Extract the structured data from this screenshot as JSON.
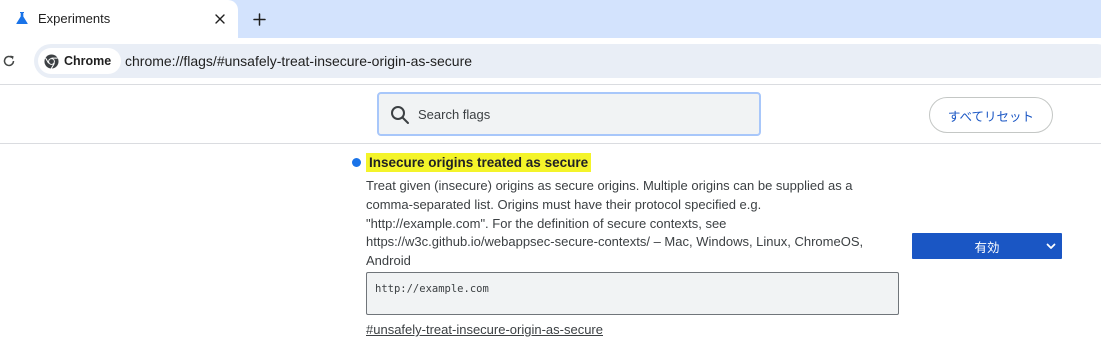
{
  "tab": {
    "title": "Experiments",
    "favicon": "flask-icon",
    "close_icon": "close-icon",
    "new_tab_icon": "plus-icon"
  },
  "toolbar": {
    "reload_icon": "reload-icon",
    "chip_label": "Chrome",
    "chip_icon": "chrome-logo-icon",
    "url": "chrome://flags/#unsafely-treat-insecure-origin-as-secure"
  },
  "header": {
    "search_placeholder": "Search flags",
    "search_icon": "search-icon",
    "reset_label": "すべてリセット"
  },
  "flag": {
    "title": "Insecure origins treated as secure",
    "description_lines": [
      "Treat given (insecure) origins as secure origins. Multiple origins can be supplied as a",
      "comma-separated list. Origins must have their protocol specified e.g.",
      "\"http://example.com\". For the definition of secure contexts, see",
      "https://w3c.github.io/webappsec-secure-contexts/ – Mac, Windows, Linux, ChromeOS,",
      "Android"
    ],
    "textarea_value": "http://example.com",
    "link": "#unsafely-treat-insecure-origin-as-secure",
    "select_value": "有効",
    "select_icon": "chevron-down-icon"
  },
  "colors": {
    "tabstrip": "#d3e3fd",
    "accent": "#1a56c4",
    "highlight": "#f4f42a",
    "dot": "#1a73e8"
  }
}
